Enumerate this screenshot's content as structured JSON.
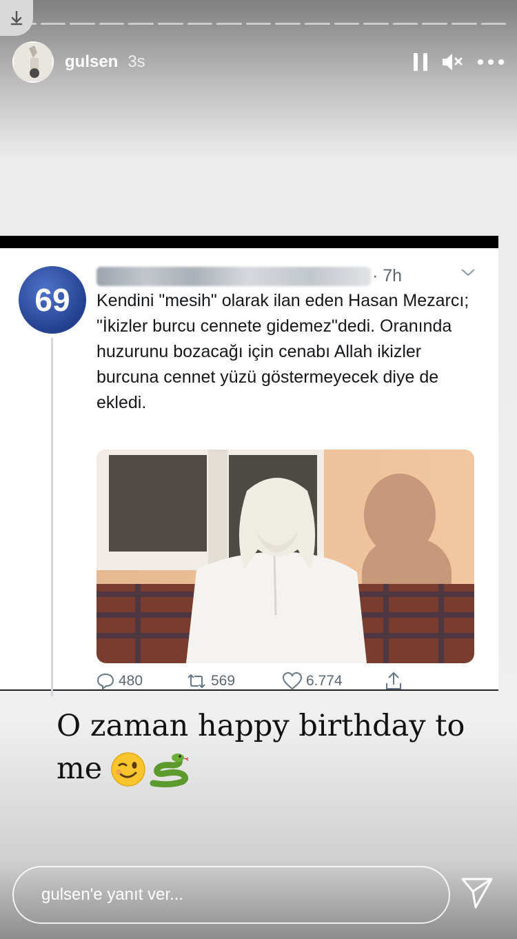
{
  "story": {
    "username": "gulsen",
    "time": "3s",
    "progress_segments": 17
  },
  "tweet": {
    "time": "· 7h",
    "avatar_text": "69",
    "text": "Kendini \"mesih\" olarak ilan eden Hasan Mezarcı; \"İkizler burcu cennete gidemez\"dedi. Oranında huzurunu bozacağı için cenabı Allah ikizler burcuna cennet yüzü göstermeyecek diye de ekledi.",
    "replies": "480",
    "retweets": "569",
    "likes": "6.774"
  },
  "caption": {
    "text": "O zaman happy birthday to me",
    "emojis": [
      "winking-face",
      "snake"
    ]
  },
  "reply": {
    "placeholder": "gulsen'e yanıt ver..."
  }
}
